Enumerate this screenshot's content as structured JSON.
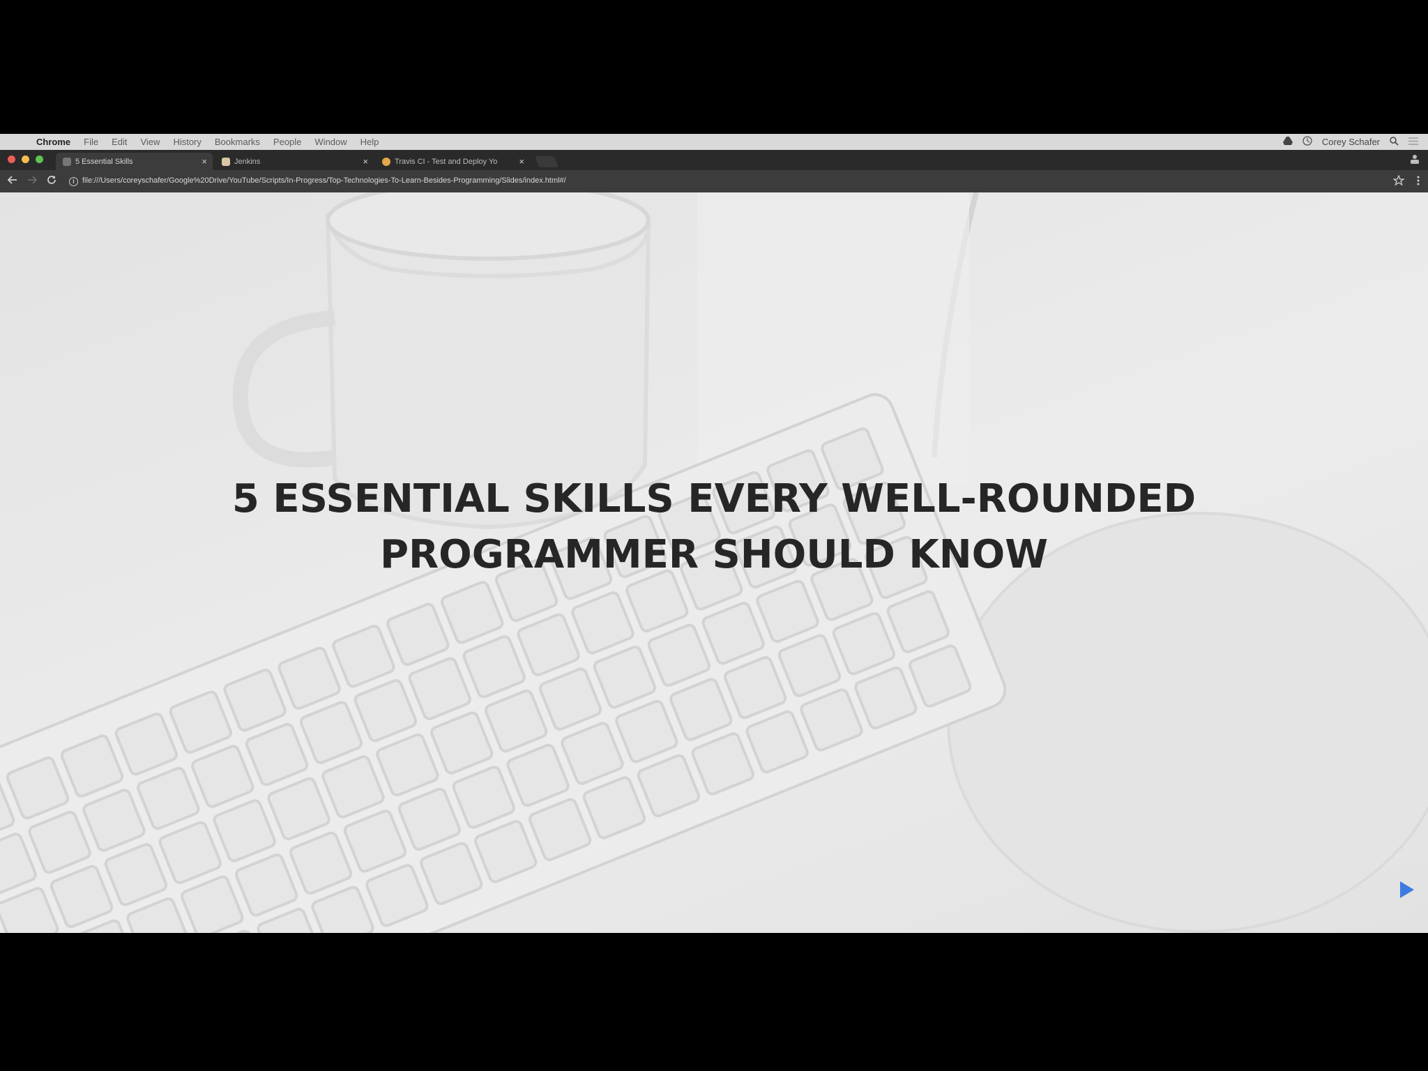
{
  "menubar": {
    "apple": "",
    "items": [
      "Chrome",
      "File",
      "Edit",
      "View",
      "History",
      "Bookmarks",
      "People",
      "Window",
      "Help"
    ],
    "user": "Corey Schafer"
  },
  "tabs": [
    {
      "title": "5 Essential Skills",
      "favicon": "slides-icon",
      "active": true
    },
    {
      "title": "Jenkins",
      "favicon": "jenkins-icon",
      "active": false
    },
    {
      "title": "Travis CI - Test and Deploy Yo",
      "favicon": "travis-icon",
      "active": false
    }
  ],
  "address_bar": {
    "url": "file:///Users/coreyschafer/Google%20Drive/YouTube/Scripts/In-Progress/Top-Technologies-To-Learn-Besides-Programming/Slides/index.html#/"
  },
  "slide": {
    "title_line1": "5 ESSENTIAL SKILLS EVERY WELL-ROUNDED",
    "title_line2": "PROGRAMMER SHOULD KNOW"
  },
  "colors": {
    "accent": "#3e7be0",
    "title_text": "#262626"
  }
}
